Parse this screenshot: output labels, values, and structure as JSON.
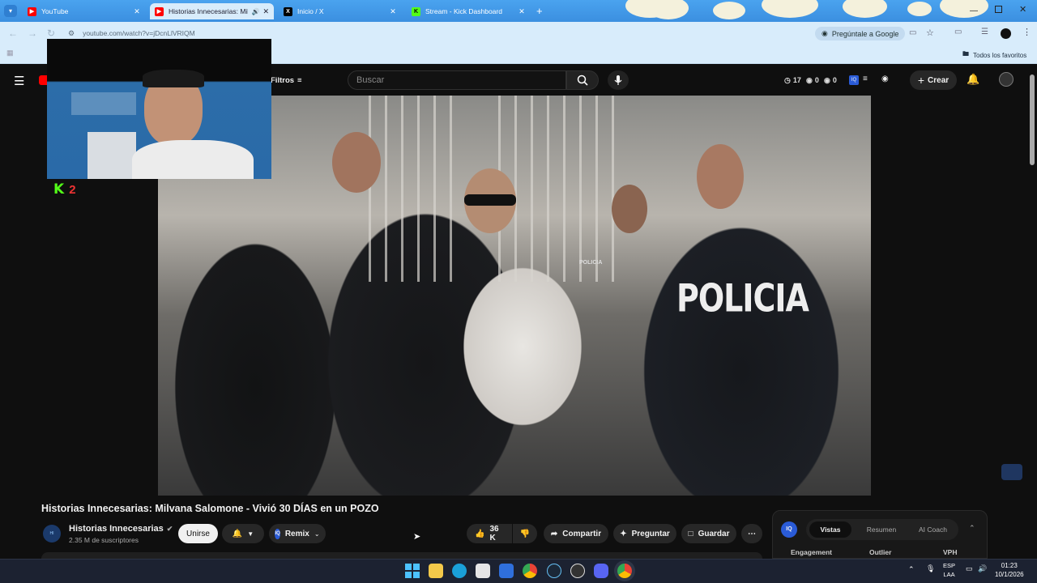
{
  "browser": {
    "tabs": [
      {
        "title": "YouTube",
        "favicon": "youtube-icon",
        "favicon_color": "#ff0000"
      },
      {
        "title": "Historias Innecesarias: Milvana Sa",
        "favicon": "youtube-icon",
        "favicon_color": "#ff0000",
        "active": true
      },
      {
        "title": "Inicio / X",
        "favicon": "x-icon",
        "favicon_color": "#000000"
      },
      {
        "title": "Stream - Kick Dashboard",
        "favicon": "kick-icon",
        "favicon_color": "#53fc18"
      }
    ],
    "url": "youtube.com/watch?v=jDcnLlVRIQM",
    "ask_google": "Pregúntale a Google",
    "bookmarks_all": "Todos los favoritos"
  },
  "youtube": {
    "filters_label": "Filtros",
    "search_placeholder": "Buscar",
    "stats": {
      "count_a": "17",
      "count_b": "0",
      "count_c": "0"
    },
    "create_label": "Crear"
  },
  "video": {
    "overlay_text": "POLICIA",
    "patch_text": "POLICIA",
    "title": "Historias Innecesarias: Milvana Salomone - Vivió 30 DÍAS en un POZO",
    "channel_name": "Historias Innecesarias",
    "subscribers": "2.35 M de suscriptores",
    "join_label": "Unirse",
    "remix_label": "Remix",
    "likes": "36 K",
    "share_label": "Compartir",
    "ask_label": "Preguntar",
    "save_label": "Guardar"
  },
  "webcam": {
    "kick_count": "2",
    "kick_color": "#53fc18"
  },
  "side_panel": {
    "tabs": [
      "Vistas",
      "Resumen",
      "AI Coach"
    ],
    "columns": [
      "Engagement",
      "Outlier",
      "VPH"
    ]
  },
  "taskbar": {
    "lang_1": "ESP",
    "lang_2": "LAA",
    "time": "01:23",
    "date": "10/1/2026"
  }
}
